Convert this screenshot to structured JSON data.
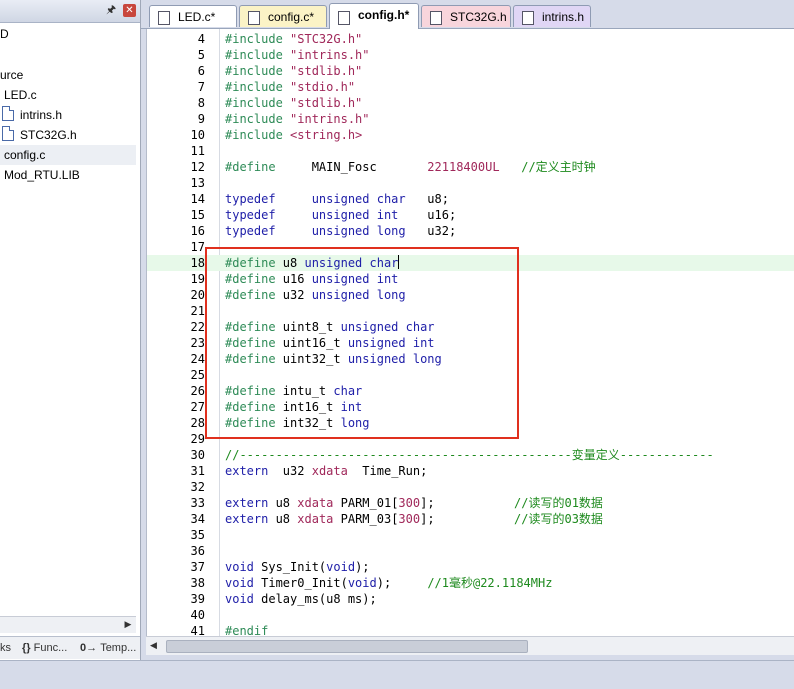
{
  "left_panel": {
    "tree": [
      {
        "label": "D",
        "indent": 0,
        "icon": null,
        "selected": false
      },
      {
        "label": "",
        "indent": 0,
        "icon": null,
        "selected": false
      },
      {
        "label": "urce",
        "indent": 0,
        "icon": null,
        "selected": false
      },
      {
        "label": "LED.c",
        "indent": 4,
        "icon": null,
        "selected": false
      },
      {
        "label": "intrins.h",
        "indent": 2,
        "icon": "file-icon",
        "selected": false
      },
      {
        "label": "STC32G.h",
        "indent": 2,
        "icon": "file-icon",
        "selected": false
      },
      {
        "label": "config.c",
        "indent": 4,
        "icon": null,
        "selected": true
      },
      {
        "label": "Mod_RTU.LIB",
        "indent": 4,
        "icon": null,
        "selected": false
      }
    ],
    "bottom_tabs": [
      {
        "label": "ks",
        "icon": ""
      },
      {
        "label": "Func...",
        "icon": "{}"
      },
      {
        "label": "Temp...",
        "icon": "0→"
      }
    ]
  },
  "tabs": [
    {
      "label": "LED.c*",
      "color": "#ffffff",
      "active": false
    },
    {
      "label": "config.c*",
      "color": "#fbf3c6",
      "active": false
    },
    {
      "label": "config.h*",
      "color": "#ffffff",
      "active": true
    },
    {
      "label": "STC32G.h",
      "color": "#f8d5dc",
      "active": false
    },
    {
      "label": "intrins.h",
      "color": "#e0d6f5",
      "active": false
    }
  ],
  "code_lines": [
    {
      "n": "4",
      "segs": [
        [
          "dir",
          "#include "
        ],
        [
          "str",
          "\"STC32G.h\""
        ]
      ]
    },
    {
      "n": "5",
      "segs": [
        [
          "dir",
          "#include "
        ],
        [
          "str",
          "\"intrins.h\""
        ]
      ]
    },
    {
      "n": "6",
      "segs": [
        [
          "dir",
          "#include "
        ],
        [
          "str",
          "\"stdlib.h\""
        ]
      ]
    },
    {
      "n": "7",
      "segs": [
        [
          "dir",
          "#include "
        ],
        [
          "str",
          "\"stdio.h\""
        ]
      ]
    },
    {
      "n": "8",
      "segs": [
        [
          "dir",
          "#include "
        ],
        [
          "str",
          "\"stdlib.h\""
        ]
      ]
    },
    {
      "n": "9",
      "segs": [
        [
          "dir",
          "#include "
        ],
        [
          "str",
          "\"intrins.h\""
        ]
      ]
    },
    {
      "n": "10",
      "segs": [
        [
          "dir",
          "#include "
        ],
        [
          "str",
          "<string.h>"
        ]
      ]
    },
    {
      "n": "11",
      "segs": []
    },
    {
      "n": "12",
      "segs": [
        [
          "dir",
          "#define"
        ],
        [
          "plain",
          "     MAIN_Fosc       "
        ],
        [
          "str",
          "22118400UL"
        ],
        [
          "plain",
          "   "
        ],
        [
          "cmt",
          "//定义主时钟"
        ]
      ]
    },
    {
      "n": "13",
      "segs": []
    },
    {
      "n": "14",
      "segs": [
        [
          "kw",
          "typedef"
        ],
        [
          "plain",
          "     "
        ],
        [
          "kw",
          "unsigned char"
        ],
        [
          "plain",
          "   u8;"
        ]
      ]
    },
    {
      "n": "15",
      "segs": [
        [
          "kw",
          "typedef"
        ],
        [
          "plain",
          "     "
        ],
        [
          "kw",
          "unsigned int"
        ],
        [
          "plain",
          "    u16;"
        ]
      ]
    },
    {
      "n": "16",
      "segs": [
        [
          "kw",
          "typedef"
        ],
        [
          "plain",
          "     "
        ],
        [
          "kw",
          "unsigned long"
        ],
        [
          "plain",
          "   u32;"
        ]
      ]
    },
    {
      "n": "17",
      "segs": []
    },
    {
      "n": "18",
      "segs": [
        [
          "dir",
          "#define"
        ],
        [
          "plain",
          " u8 "
        ],
        [
          "kw",
          "unsigned char"
        ]
      ],
      "current": true
    },
    {
      "n": "19",
      "segs": [
        [
          "dir",
          "#define"
        ],
        [
          "plain",
          " u16 "
        ],
        [
          "kw",
          "unsigned int"
        ]
      ]
    },
    {
      "n": "20",
      "segs": [
        [
          "dir",
          "#define"
        ],
        [
          "plain",
          " u32 "
        ],
        [
          "kw",
          "unsigned long"
        ]
      ]
    },
    {
      "n": "21",
      "segs": []
    },
    {
      "n": "22",
      "segs": [
        [
          "dir",
          "#define"
        ],
        [
          "plain",
          " uint8_t "
        ],
        [
          "kw",
          "unsigned char"
        ]
      ]
    },
    {
      "n": "23",
      "segs": [
        [
          "dir",
          "#define"
        ],
        [
          "plain",
          " uint16_t "
        ],
        [
          "kw",
          "unsigned int"
        ]
      ]
    },
    {
      "n": "24",
      "segs": [
        [
          "dir",
          "#define"
        ],
        [
          "plain",
          " uint32_t "
        ],
        [
          "kw",
          "unsigned long"
        ]
      ]
    },
    {
      "n": "25",
      "segs": []
    },
    {
      "n": "26",
      "segs": [
        [
          "dir",
          "#define"
        ],
        [
          "plain",
          " intu_t "
        ],
        [
          "kw",
          "char"
        ]
      ]
    },
    {
      "n": "27",
      "segs": [
        [
          "dir",
          "#define"
        ],
        [
          "plain",
          " int16_t "
        ],
        [
          "kw",
          "int"
        ]
      ]
    },
    {
      "n": "28",
      "segs": [
        [
          "dir",
          "#define"
        ],
        [
          "plain",
          " int32_t "
        ],
        [
          "kw",
          "long"
        ]
      ]
    },
    {
      "n": "29",
      "segs": []
    },
    {
      "n": "30",
      "segs": [
        [
          "cmt",
          "//----------------------------------------------变量定义-------------"
        ]
      ]
    },
    {
      "n": "31",
      "segs": [
        [
          "kw",
          "extern"
        ],
        [
          "plain",
          "  u32 "
        ],
        [
          "str",
          "xdata"
        ],
        [
          "plain",
          "  Time_Run;"
        ]
      ]
    },
    {
      "n": "32",
      "segs": []
    },
    {
      "n": "33",
      "segs": [
        [
          "kw",
          "extern"
        ],
        [
          "plain",
          " u8 "
        ],
        [
          "str",
          "xdata"
        ],
        [
          "plain",
          " PARM_01["
        ],
        [
          "str",
          "300"
        ],
        [
          "plain",
          "];           "
        ],
        [
          "cmt",
          "//读写的01数据"
        ]
      ]
    },
    {
      "n": "34",
      "segs": [
        [
          "kw",
          "extern"
        ],
        [
          "plain",
          " u8 "
        ],
        [
          "str",
          "xdata"
        ],
        [
          "plain",
          " PARM_03["
        ],
        [
          "str",
          "300"
        ],
        [
          "plain",
          "];           "
        ],
        [
          "cmt",
          "//读写的03数据"
        ]
      ]
    },
    {
      "n": "35",
      "segs": []
    },
    {
      "n": "36",
      "segs": []
    },
    {
      "n": "37",
      "segs": [
        [
          "kw",
          "void"
        ],
        [
          "plain",
          " Sys_Init("
        ],
        [
          "kw",
          "void"
        ],
        [
          "plain",
          ");"
        ]
      ]
    },
    {
      "n": "38",
      "segs": [
        [
          "kw",
          "void"
        ],
        [
          "plain",
          " Timer0_Init("
        ],
        [
          "kw",
          "void"
        ],
        [
          "plain",
          ");     "
        ],
        [
          "cmt",
          "//1毫秒@22.1184MHz"
        ]
      ]
    },
    {
      "n": "39",
      "segs": [
        [
          "kw",
          "void"
        ],
        [
          "plain",
          " delay_ms(u8 ms);"
        ]
      ]
    },
    {
      "n": "40",
      "segs": []
    },
    {
      "n": "41",
      "segs": [
        [
          "dir",
          "#endif"
        ]
      ]
    }
  ],
  "colors": {
    "directive": "#2e8b57",
    "keyword": "#1e1ea8",
    "string": "#a0285a",
    "comment": "#1e8a1e",
    "highlight_box": "#e0301e",
    "current_line": "#e7f9e9"
  }
}
